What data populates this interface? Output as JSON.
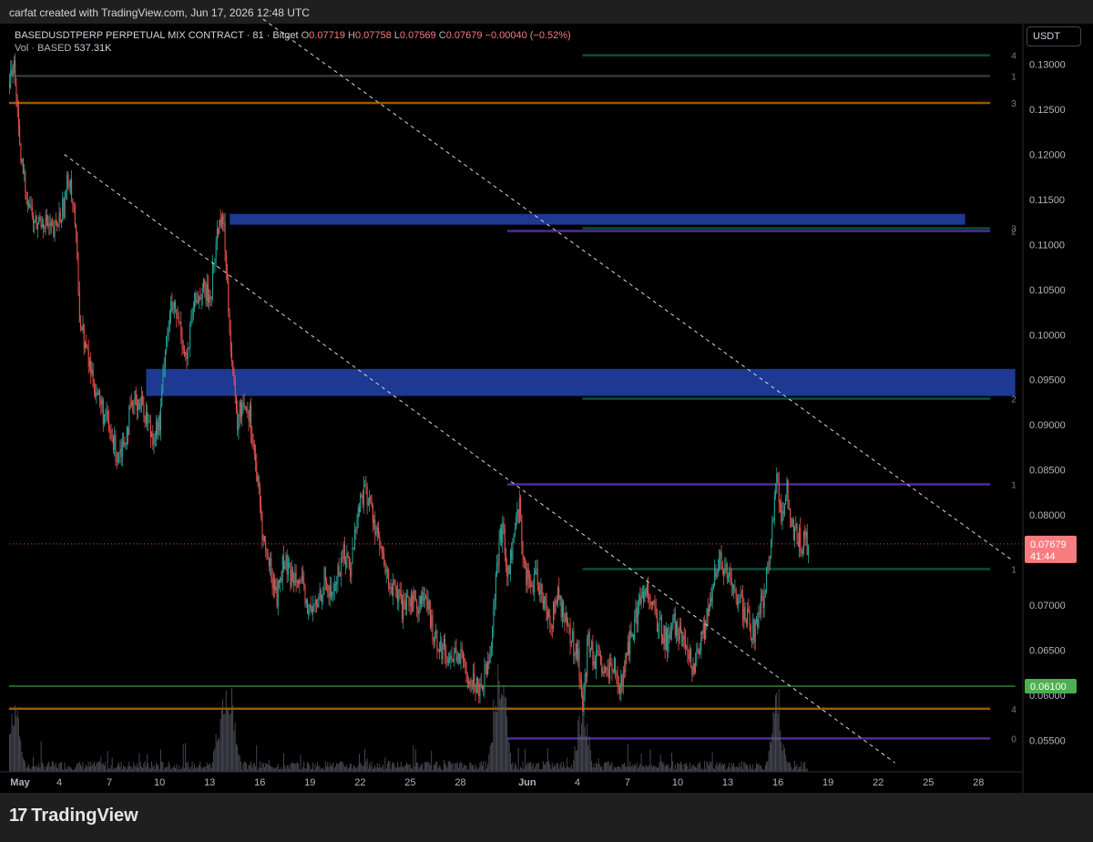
{
  "header": {
    "credit": "carfat created with TradingView.com, Jun 17, 2026 12:48 UTC"
  },
  "legend": {
    "symbol": "BASEDUSDTPERP PERPETUAL MIX CONTRACT · 81 · Bitget",
    "o_label": "O",
    "o": "0.07719",
    "h_label": "H",
    "h": "0.07758",
    "l_label": "L",
    "l": "0.07569",
    "c_label": "C",
    "c": "0.07679",
    "change": "−0.00040 (−0.52%)",
    "vol_label": "Vol · BASED",
    "vol_value": "537.31K"
  },
  "currency_button": "USDT",
  "brand": "TradingView",
  "colors": {
    "up": "#26a69a",
    "down": "#ef5350",
    "zone": "#1f3c9a",
    "trendline": "#d9d9d9",
    "green_level": "#4caf50",
    "orange_level": "#b26a00",
    "purple_level": "#5e35b1",
    "teal_level": "#0f5c4a",
    "last_price_badge": "#f77c80",
    "support_badge": "#4caf50"
  },
  "chart_data": {
    "type": "candlestick",
    "ylim": [
      0.0515,
      0.1345
    ],
    "xlim_days_from_may1": [
      0,
      60.2
    ],
    "grid": false,
    "y_ticks": [
      "0.13000",
      "0.12500",
      "0.12000",
      "0.11500",
      "0.11000",
      "0.10500",
      "0.10000",
      "0.09500",
      "0.09000",
      "0.08500",
      "0.08000",
      "0.07000",
      "0.06500",
      "0.06000",
      "0.05500"
    ],
    "x_ticks": [
      {
        "label": "May",
        "day": 0
      },
      {
        "label": "4",
        "day": 3
      },
      {
        "label": "7",
        "day": 6
      },
      {
        "label": "10",
        "day": 9
      },
      {
        "label": "13",
        "day": 12
      },
      {
        "label": "16",
        "day": 15
      },
      {
        "label": "19",
        "day": 18
      },
      {
        "label": "22",
        "day": 21
      },
      {
        "label": "25",
        "day": 24
      },
      {
        "label": "28",
        "day": 27
      },
      {
        "label": "Jun",
        "day": 31
      },
      {
        "label": "4",
        "day": 34
      },
      {
        "label": "7",
        "day": 37
      },
      {
        "label": "10",
        "day": 40
      },
      {
        "label": "13",
        "day": 43
      },
      {
        "label": "16",
        "day": 46
      },
      {
        "label": "19",
        "day": 49
      },
      {
        "label": "22",
        "day": 52
      },
      {
        "label": "25",
        "day": 55
      },
      {
        "label": "28",
        "day": 58
      }
    ],
    "last_price": {
      "value": 0.07679,
      "label": "0.07679",
      "countdown": "41:44"
    },
    "support_price": {
      "value": 0.061,
      "label": "0.06100"
    },
    "price_path": [
      [
        0,
        0.128
      ],
      [
        0.3,
        0.13
      ],
      [
        0.6,
        0.12
      ],
      [
        1.0,
        0.116
      ],
      [
        1.5,
        0.112
      ],
      [
        2.0,
        0.113
      ],
      [
        2.6,
        0.111
      ],
      [
        3.2,
        0.114
      ],
      [
        3.6,
        0.118
      ],
      [
        3.9,
        0.113
      ],
      [
        4.2,
        0.102
      ],
      [
        4.6,
        0.098
      ],
      [
        5.0,
        0.095
      ],
      [
        5.5,
        0.092
      ],
      [
        6.0,
        0.089
      ],
      [
        6.4,
        0.087
      ],
      [
        6.8,
        0.088
      ],
      [
        7.2,
        0.091
      ],
      [
        7.6,
        0.093
      ],
      [
        8.0,
        0.092
      ],
      [
        8.5,
        0.089
      ],
      [
        9.0,
        0.09
      ],
      [
        9.3,
        0.099
      ],
      [
        9.7,
        0.103
      ],
      [
        10.2,
        0.101
      ],
      [
        10.6,
        0.097
      ],
      [
        11.0,
        0.103
      ],
      [
        11.5,
        0.105
      ],
      [
        12.0,
        0.104
      ],
      [
        12.4,
        0.111
      ],
      [
        12.7,
        0.114
      ],
      [
        13.0,
        0.107
      ],
      [
        13.3,
        0.097
      ],
      [
        13.6,
        0.09
      ],
      [
        14.0,
        0.093
      ],
      [
        14.4,
        0.091
      ],
      [
        14.8,
        0.084
      ],
      [
        15.2,
        0.077
      ],
      [
        15.6,
        0.074
      ],
      [
        16.0,
        0.071
      ],
      [
        16.4,
        0.075
      ],
      [
        16.8,
        0.073
      ],
      [
        17.2,
        0.074
      ],
      [
        17.6,
        0.071
      ],
      [
        18.0,
        0.069
      ],
      [
        18.4,
        0.07
      ],
      [
        18.8,
        0.073
      ],
      [
        19.2,
        0.071
      ],
      [
        19.6,
        0.073
      ],
      [
        20.0,
        0.076
      ],
      [
        20.4,
        0.074
      ],
      [
        20.8,
        0.08
      ],
      [
        21.2,
        0.083
      ],
      [
        21.6,
        0.081
      ],
      [
        22.0,
        0.078
      ],
      [
        22.4,
        0.074
      ],
      [
        22.8,
        0.072
      ],
      [
        23.2,
        0.071
      ],
      [
        23.6,
        0.069
      ],
      [
        24.0,
        0.071
      ],
      [
        24.4,
        0.07
      ],
      [
        24.8,
        0.071
      ],
      [
        25.2,
        0.068
      ],
      [
        25.6,
        0.066
      ],
      [
        26.0,
        0.065
      ],
      [
        26.4,
        0.064
      ],
      [
        26.8,
        0.065
      ],
      [
        27.2,
        0.063
      ],
      [
        27.6,
        0.062
      ],
      [
        28.0,
        0.061
      ],
      [
        28.4,
        0.062
      ],
      [
        28.8,
        0.066
      ],
      [
        29.2,
        0.075
      ],
      [
        29.5,
        0.079
      ],
      [
        29.8,
        0.073
      ],
      [
        30.2,
        0.078
      ],
      [
        30.5,
        0.081
      ],
      [
        30.8,
        0.074
      ],
      [
        31.2,
        0.072
      ],
      [
        31.6,
        0.073
      ],
      [
        32.0,
        0.07
      ],
      [
        32.4,
        0.068
      ],
      [
        32.8,
        0.071
      ],
      [
        33.2,
        0.069
      ],
      [
        33.6,
        0.066
      ],
      [
        34.0,
        0.065
      ],
      [
        34.3,
        0.058
      ],
      [
        34.6,
        0.066
      ],
      [
        35.0,
        0.064
      ],
      [
        35.4,
        0.063
      ],
      [
        35.8,
        0.062
      ],
      [
        36.2,
        0.063
      ],
      [
        36.6,
        0.061
      ],
      [
        37.0,
        0.065
      ],
      [
        37.4,
        0.068
      ],
      [
        37.8,
        0.071
      ],
      [
        38.2,
        0.072
      ],
      [
        38.6,
        0.069
      ],
      [
        39.0,
        0.067
      ],
      [
        39.4,
        0.066
      ],
      [
        39.8,
        0.068
      ],
      [
        40.2,
        0.066
      ],
      [
        40.6,
        0.064
      ],
      [
        41.0,
        0.063
      ],
      [
        41.4,
        0.066
      ],
      [
        41.8,
        0.069
      ],
      [
        42.2,
        0.073
      ],
      [
        42.6,
        0.075
      ],
      [
        43.0,
        0.073
      ],
      [
        43.4,
        0.071
      ],
      [
        43.8,
        0.07
      ],
      [
        44.2,
        0.068
      ],
      [
        44.6,
        0.067
      ],
      [
        45.0,
        0.07
      ],
      [
        45.4,
        0.074
      ],
      [
        45.7,
        0.08
      ],
      [
        45.9,
        0.085
      ],
      [
        46.2,
        0.079
      ],
      [
        46.5,
        0.083
      ],
      [
        46.8,
        0.079
      ],
      [
        47.1,
        0.078
      ],
      [
        47.4,
        0.077
      ],
      [
        47.8,
        0.0768
      ]
    ],
    "volume_spikes_days": [
      0.3,
      12.7,
      13.3,
      29.2,
      29.5,
      34.3,
      45.9
    ]
  },
  "annotations": {
    "zones": [
      {
        "name": "upper-supply-zone",
        "day_start": 13.2,
        "day_end": 57.2,
        "y_top": 0.1134,
        "y_bottom": 0.1122
      },
      {
        "name": "middle-supply-zone",
        "day_start": 8.2,
        "day_end": 60.2,
        "y_top": 0.0962,
        "y_bottom": 0.0932
      }
    ],
    "levels": [
      {
        "name": "level-teal-top",
        "day_start": 34.3,
        "day_end": 58.7,
        "y": 0.131,
        "label": "4",
        "color": "teal_level"
      },
      {
        "name": "level-grey-top",
        "day_start": 0,
        "day_end": 58.7,
        "y": 0.1287,
        "label": "1",
        "color": "trendline"
      },
      {
        "name": "level-orange-top",
        "day_start": 0,
        "day_end": 58.7,
        "y": 0.1257,
        "label": "3",
        "color": "orange_level"
      },
      {
        "name": "level-purple-upper",
        "day_start": 29.8,
        "day_end": 58.7,
        "y": 0.1115,
        "label": "2",
        "color": "purple_level"
      },
      {
        "name": "level-teal-upper",
        "day_start": 34.3,
        "day_end": 58.7,
        "y": 0.1118,
        "label": "3",
        "color": "teal_level"
      },
      {
        "name": "level-teal-mid",
        "day_start": 34.3,
        "day_end": 58.7,
        "y": 0.0929,
        "label": "2",
        "color": "teal_level"
      },
      {
        "name": "level-purple-mid",
        "day_start": 29.8,
        "day_end": 58.7,
        "y": 0.0834,
        "label": "1",
        "color": "purple_level"
      },
      {
        "name": "level-teal-low",
        "day_start": 34.3,
        "day_end": 58.7,
        "y": 0.074,
        "label": "1",
        "color": "teal_level"
      },
      {
        "name": "level-green-support",
        "day_start": 0,
        "day_end": 60.2,
        "y": 0.061,
        "label": "",
        "color": "green_level"
      },
      {
        "name": "level-orange-low",
        "day_start": 0,
        "day_end": 58.7,
        "y": 0.0585,
        "label": "4",
        "color": "orange_level"
      },
      {
        "name": "level-purple-low",
        "day_start": 29.8,
        "day_end": 58.7,
        "y": 0.0552,
        "label": "0",
        "color": "purple_level"
      }
    ],
    "trendlines": [
      {
        "name": "trendline-lower",
        "from": [
          3.3,
          0.12
        ],
        "to": [
          53.0,
          0.0525
        ]
      },
      {
        "name": "trendline-upper",
        "from": [
          15.2,
          0.135
        ],
        "to": [
          60.0,
          0.075
        ]
      }
    ]
  }
}
